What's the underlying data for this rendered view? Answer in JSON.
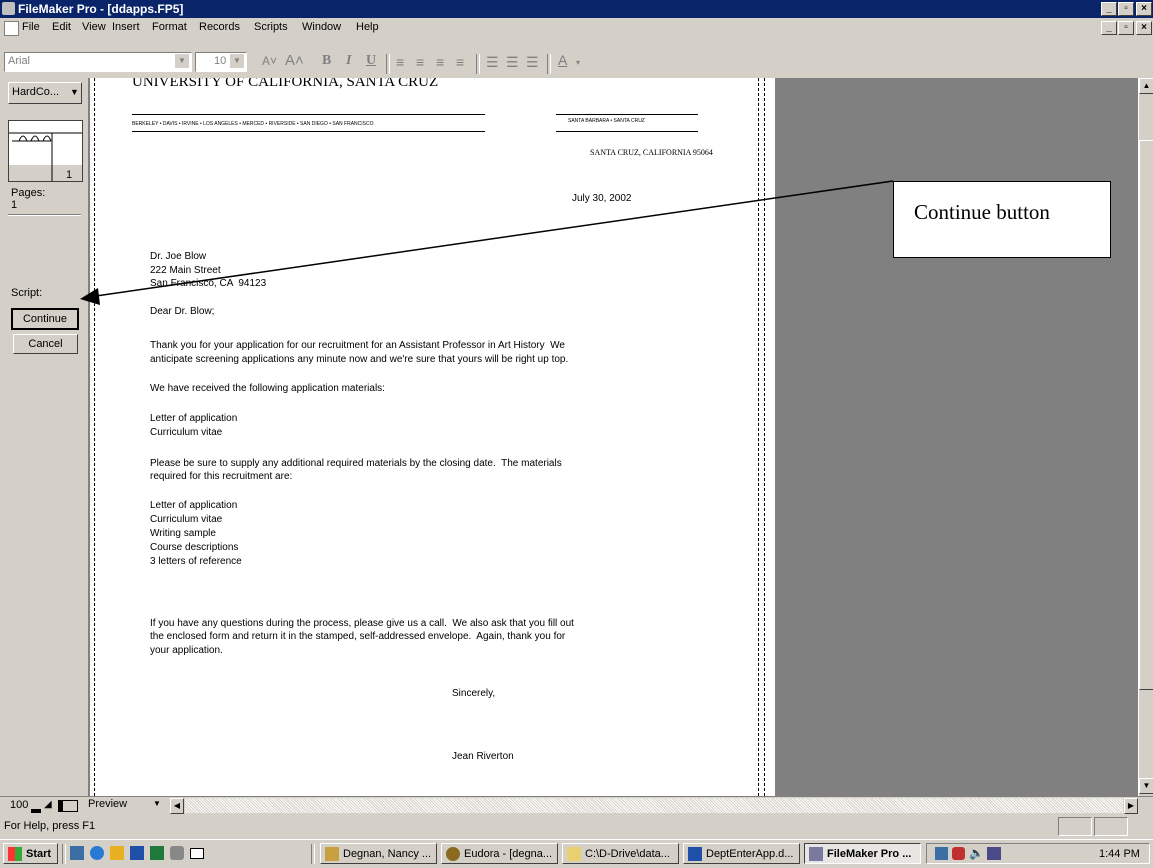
{
  "window": {
    "title": "FileMaker Pro - [ddapps.FP5]"
  },
  "menu": [
    "File",
    "Edit",
    "View",
    "Insert",
    "Format",
    "Records",
    "Scripts",
    "Window",
    "Help"
  ],
  "toolbar": {
    "font": "Arial",
    "size": "10"
  },
  "status_area": {
    "layout": "HardCo...",
    "page_number": "1",
    "pages_label": "Pages:",
    "pages_value": "1",
    "script_label": "Script:",
    "continue": "Continue",
    "cancel": "Cancel"
  },
  "letter": {
    "university": "UNIVERSITY OF CALIFORNIA, SANTA CRUZ",
    "campuses_left": "BERKELEY • DAVIS • IRVINE • LOS ANGELES • MERCED • RIVERSIDE • SAN DIEGO • SAN FRANCISCO",
    "campuses_right": "SANTA BARBARA • SANTA CRUZ",
    "city": "SANTA CRUZ, CALIFORNIA 95064",
    "date": "July 30, 2002",
    "addr1": "Dr. Joe Blow",
    "addr2": "222 Main Street",
    "addr3": "San Francisco, CA  94123",
    "salutation": "Dear Dr. Blow;",
    "p1a": "Thank you for your application for our recruitment for an Assistant Professor in Art History  We",
    "p1b": "anticipate screening applications any minute now and we're sure that yours will be right up top.",
    "p2": "We have received the following application materials:",
    "r1": "Letter of application",
    "r2": "Curriculum vitae",
    "p3a": "Please be sure to supply any additional required materials by the closing date.  The materials",
    "p3b": "required for this recruitment are:",
    "q1": "Letter of application",
    "q2": "Curriculum vitae",
    "q3": "Writing sample",
    "q4": "Course descriptions",
    "q5": "3 letters of reference",
    "p4a": "If you have any questions during the process, please give us a call.  We also ask that you fill out",
    "p4b": "the enclosed form and return it in the stamped, self-addressed envelope.  Again, thank you for",
    "p4c": "your application.",
    "closing": "Sincerely,",
    "signer": "Jean Riverton"
  },
  "bottom": {
    "zoom": "100",
    "mode": "Preview"
  },
  "status": "For Help, press F1",
  "taskbar": {
    "start": "Start",
    "tasks": [
      "Degnan, Nancy ...",
      "Eudora - [degna...",
      "C:\\D-Drive\\data...",
      "DeptEnterApp.d...",
      "FileMaker Pro ..."
    ],
    "clock": "1:44 PM"
  },
  "annotation": "Continue button"
}
